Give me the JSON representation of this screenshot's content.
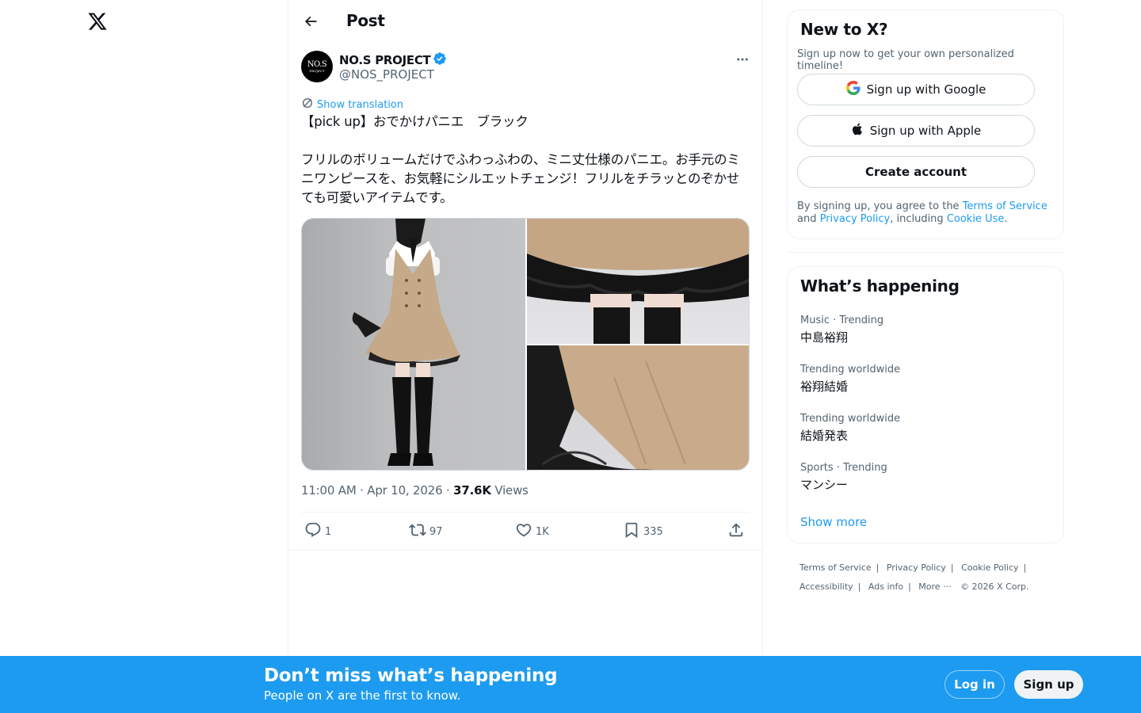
{
  "nav": {
    "logo_icon": "x-logo-icon"
  },
  "header": {
    "title": "Post",
    "back_icon": "arrow-left-icon"
  },
  "post": {
    "avatar_line1": "NO.S",
    "avatar_line2": "PROJECT",
    "display_name": "NO.S PROJECT",
    "verified": true,
    "handle": "@NOS_PROJECT",
    "show_translation": "Show translation",
    "text": "【pick up】おでかけパニエ　ブラック\n\nフリルのボリュームだけでふわっふわの、ミニ丈仕様のパニエ。お手元のミニワンピースを、お気軽にシルエットチェンジ！フリルをチラッとのぞかせても可愛いアイテムです。",
    "time": "11:00 AM · Apr 10, 2026",
    "views_count": "37.6K",
    "views_label": "Views",
    "actions": {
      "replies": "1",
      "reposts": "97",
      "likes": "1K",
      "bookmarks": "335"
    },
    "accent": "#1d9bf0"
  },
  "signup": {
    "title": "New to X?",
    "subtitle": "Sign up now to get your own personalized timeline!",
    "google": "Sign up with Google",
    "apple": "Sign up with Apple",
    "create": "Create account",
    "legal_pre": "By signing up, you agree to the ",
    "tos": "Terms of Service",
    "legal_and": " and ",
    "privacy": "Privacy Policy",
    "legal_incl": ", including ",
    "cookie": "Cookie Use",
    "legal_end": "."
  },
  "trends": {
    "title": "What’s happening",
    "items": [
      {
        "category": "Music · Trending",
        "name": "中島裕翔"
      },
      {
        "category": "Trending worldwide",
        "name": "裕翔結婚"
      },
      {
        "category": "Trending worldwide",
        "name": "結婚発表"
      },
      {
        "category": "Sports · Trending",
        "name": "マンシー"
      }
    ],
    "show_more": "Show more"
  },
  "footer": {
    "links": [
      "Terms of Service",
      "Privacy Policy",
      "Cookie Policy",
      "Accessibility",
      "Ads info",
      "More ···"
    ],
    "copyright": "© 2026 X Corp."
  },
  "banner": {
    "title": "Don’t miss what’s happening",
    "subtitle": "People on X are the first to know.",
    "login": "Log in",
    "signup": "Sign up",
    "color": "#1d9bf0"
  }
}
